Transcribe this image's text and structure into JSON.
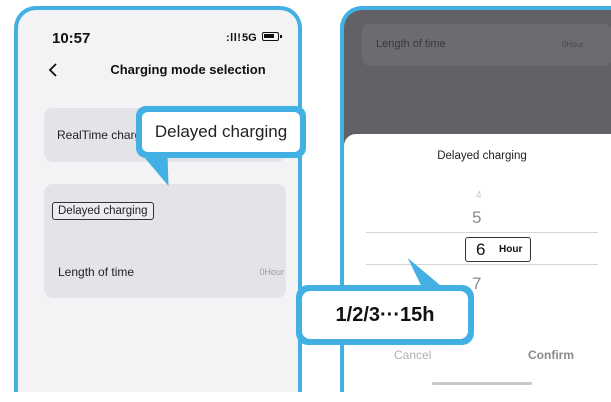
{
  "left": {
    "status": {
      "time": "10:57",
      "signal": ":ll!",
      "network": "5G"
    },
    "nav": {
      "title": "Charging mode selection"
    },
    "cards": {
      "realtime_label": "RealTime charging",
      "delayed_chip": "Delayed charging",
      "length_label": "Length of time",
      "length_value": "0Hour"
    },
    "bubble_text": "Delayed charging"
  },
  "right": {
    "dim_card": {
      "label": "Length of time",
      "value": "0Hour"
    },
    "sheet": {
      "title": "Delayed charging",
      "wheel_above_2": "4",
      "wheel_above_1": "5",
      "selected_value": "6",
      "selected_unit": "Hour",
      "wheel_below": "7",
      "cancel_label": "Cancel",
      "confirm_label": "Confirm"
    },
    "callout_text": "1/2/3···15h"
  },
  "colors": {
    "accent": "#43b0e4",
    "card": "#e4e4e8",
    "overlay": "#626266"
  },
  "icons": [
    "back-chevron-icon",
    "battery-icon"
  ]
}
